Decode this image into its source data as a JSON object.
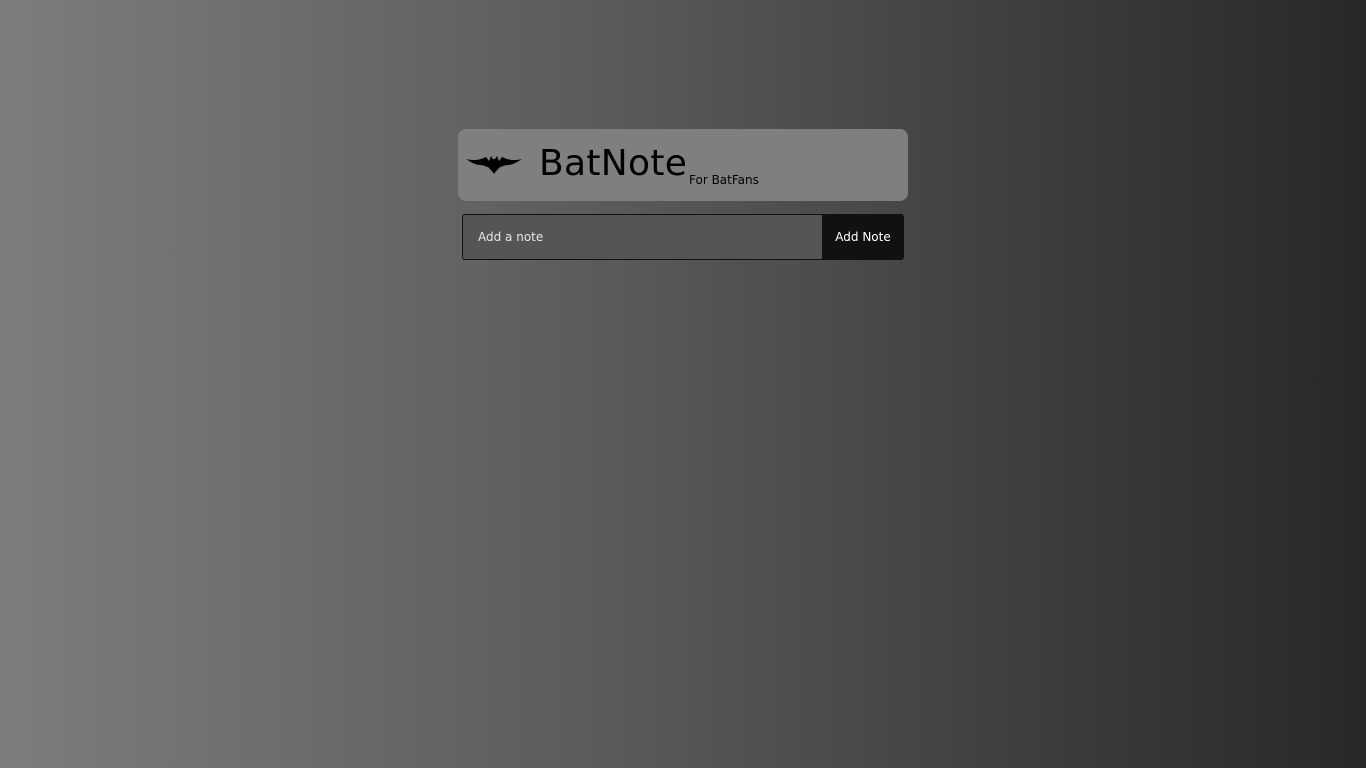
{
  "header": {
    "logo_icon": "bat-logo-icon",
    "title": "BatNote",
    "subtitle": "For BatFans"
  },
  "note_form": {
    "input_placeholder": "Add a note",
    "input_value": "",
    "button_label": "Add Note"
  },
  "colors": {
    "header_bg": "#7f7f7f",
    "input_bg": "#555555",
    "button_bg": "#111111",
    "button_text": "#ffffff"
  }
}
